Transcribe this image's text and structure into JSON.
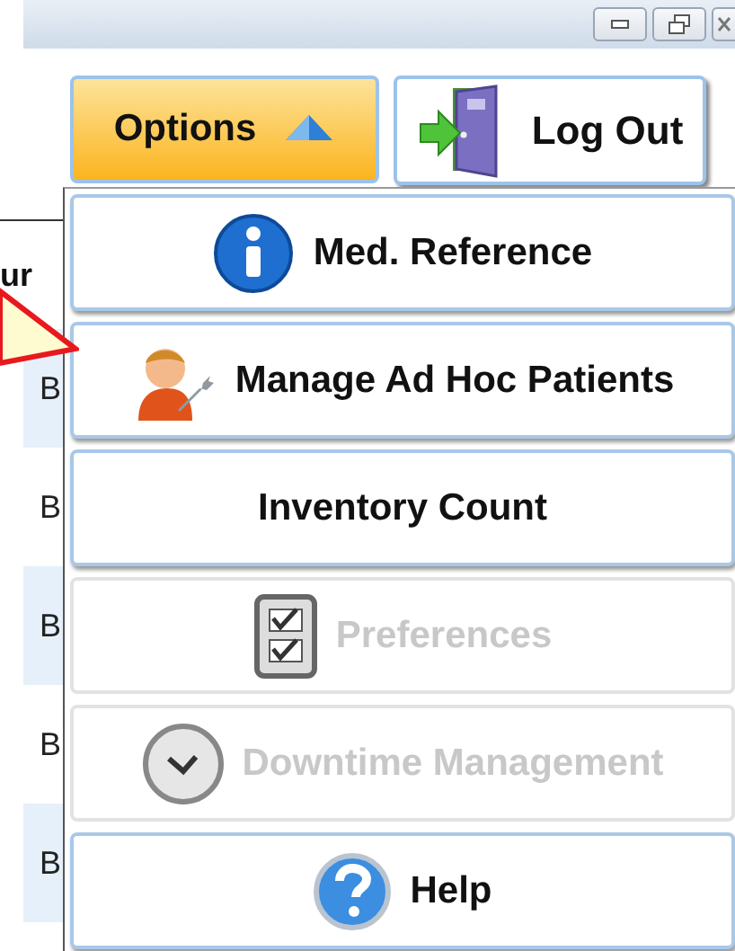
{
  "toolbar": {
    "options": {
      "label": "Options",
      "expanded": true
    },
    "logout": {
      "label": "Log Out"
    }
  },
  "table": {
    "header": "ur",
    "rows": [
      {
        "cell": "B",
        "shaded": true
      },
      {
        "cell": "B",
        "shaded": false
      },
      {
        "cell": "B",
        "shaded": true
      },
      {
        "cell": "B",
        "shaded": false
      },
      {
        "cell": "B",
        "shaded": true
      }
    ]
  },
  "menu": [
    {
      "label": "Med. Reference",
      "disabled": false
    },
    {
      "label": "Manage Ad Hoc Patients",
      "disabled": false
    },
    {
      "label": "Inventory Count",
      "disabled": false
    },
    {
      "label": "Preferences",
      "disabled": true
    },
    {
      "label": "Downtime Management",
      "disabled": true
    },
    {
      "label": "Help",
      "disabled": false
    }
  ]
}
